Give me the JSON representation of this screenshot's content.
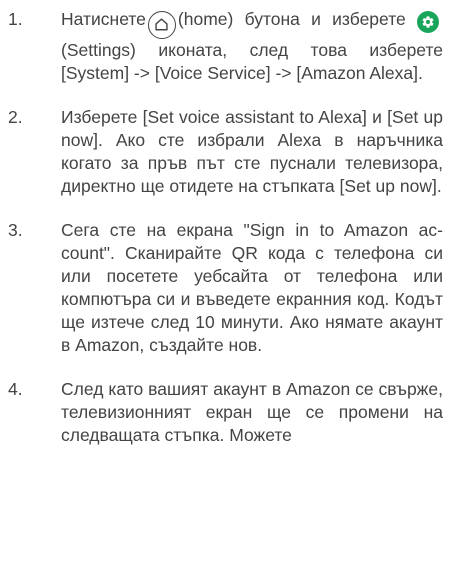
{
  "steps": [
    {
      "number": "1.",
      "text_before_home": "Натиснете",
      "home_label": "(home) бутона и изберете",
      "settings_label": "(Settings) иконата, след това изберете [System] -> [Voice Service] -> [Amazon Alexa]."
    },
    {
      "number": "2.",
      "text": "Изберете [Set voice assistant to Alexa] и [Set up now]. Ако сте избрали Alexa в наръчника когато за пръв път сте пуснали телевизора, директно ще отидете на стъпката [Set up now]."
    },
    {
      "number": "3.",
      "text": "Сега сте на екрана \"Sign in to Amazon ac­count\". Сканирайте QR кода с телефона си или посетете уебсайта от телефона или компютъра си и въведете екранния код. Кодът ще изтече след 10 минути. Ако нямате акаунт в Amazon, създайте нов."
    },
    {
      "number": "4.",
      "text": "След като вашият акаунт в Amazon се свърже, телевизионният екран ще се промени на следващата стъпка. Можете"
    }
  ],
  "icons": {
    "home": "home-icon",
    "settings": "gear-icon",
    "settings_color": "#1aa65a"
  }
}
